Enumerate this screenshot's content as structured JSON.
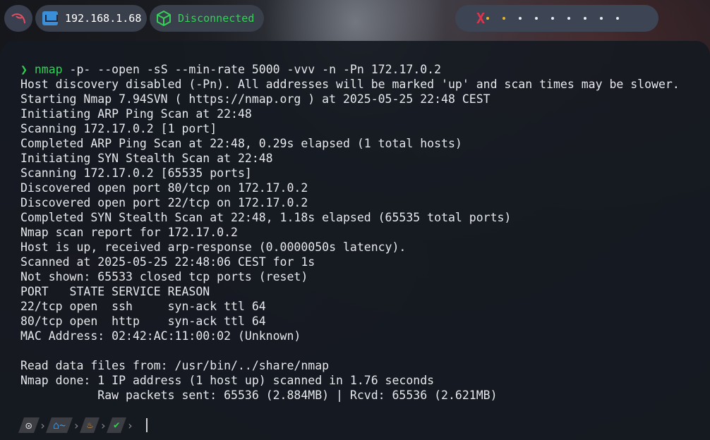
{
  "topbar": {
    "ip_address": "192.168.1.68",
    "vpn_status": "Disconnected",
    "workspace_active_marker": "X",
    "workspace_dots": 9
  },
  "terminal": {
    "command": {
      "name": "nmap",
      "args": " -p- --open -sS --min-rate 5000 -vvv -n -Pn 172.17.0.2"
    },
    "output": [
      "Host discovery disabled (-Pn). All addresses will be marked 'up' and scan times may be slower.",
      "Starting Nmap 7.94SVN ( https://nmap.org ) at 2025-05-25 22:48 CEST",
      "Initiating ARP Ping Scan at 22:48",
      "Scanning 172.17.0.2 [1 port]",
      "Completed ARP Ping Scan at 22:48, 0.29s elapsed (1 total hosts)",
      "Initiating SYN Stealth Scan at 22:48",
      "Scanning 172.17.0.2 [65535 ports]",
      "Discovered open port 80/tcp on 172.17.0.2",
      "Discovered open port 22/tcp on 172.17.0.2",
      "Completed SYN Stealth Scan at 22:48, 1.18s elapsed (65535 total ports)",
      "Nmap scan report for 172.17.0.2",
      "Host is up, received arp-response (0.0000050s latency).",
      "Scanned at 2025-05-25 22:48:06 CEST for 1s",
      "Not shown: 65533 closed tcp ports (reset)",
      "PORT   STATE SERVICE REASON",
      "22/tcp open  ssh     syn-ack ttl 64",
      "80/tcp open  http    syn-ack ttl 64",
      "MAC Address: 02:42:AC:11:00:02 (Unknown)",
      "",
      "Read data files from: /usr/bin/../share/nmap",
      "Nmap done: 1 IP address (1 host up) scanned in 1.76 seconds",
      "           Raw packets sent: 65536 (2.884MB) | Rcvd: 65536 (2.621MB)"
    ],
    "prompt": {
      "home_label": "~",
      "icons": [
        "debian-icon",
        "home-icon",
        "fire-icon",
        "check-icon"
      ]
    }
  },
  "colors": {
    "accent_green": "#34d058",
    "workspace_active": "#e0344a",
    "text": "#e6e8ec"
  }
}
